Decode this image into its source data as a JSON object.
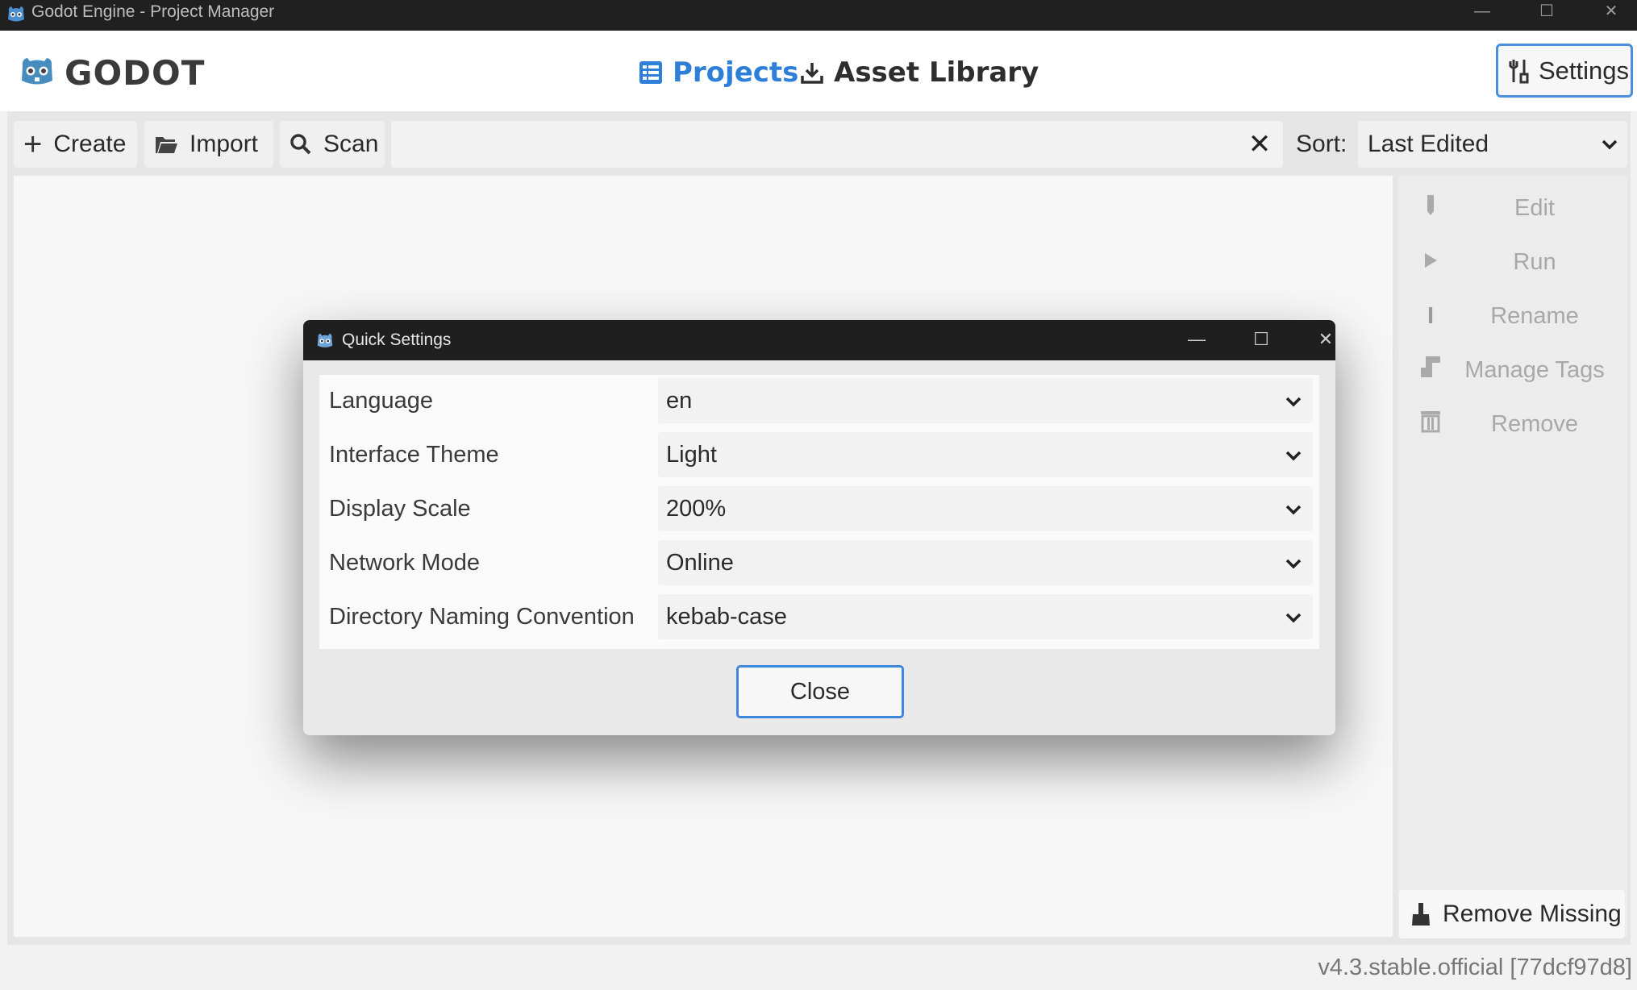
{
  "window": {
    "title": "Godot Engine - Project Manager",
    "controls": [
      "minimize-icon",
      "maximize-icon",
      "close-icon"
    ]
  },
  "header": {
    "logo_text": "GODOT",
    "tabs": [
      {
        "label": "Projects",
        "icon": "project-list-icon",
        "active": true
      },
      {
        "label": "Asset Library",
        "icon": "download-icon",
        "active": false
      }
    ],
    "settings_label": "Settings"
  },
  "toolbar": {
    "create_label": "Create",
    "import_label": "Import",
    "scan_label": "Scan",
    "search": {
      "value": "",
      "placeholder": ""
    },
    "sort_label": "Sort:",
    "sort_value": "Last Edited"
  },
  "side_panel": {
    "items": [
      {
        "label": "Edit",
        "icon": "pencil-icon",
        "enabled": false
      },
      {
        "label": "Run",
        "icon": "play-icon",
        "enabled": false
      },
      {
        "label": "Rename",
        "icon": "text-cursor-icon",
        "enabled": false
      },
      {
        "label": "Manage Tags",
        "icon": "tag-icon",
        "enabled": false
      },
      {
        "label": "Remove",
        "icon": "trash-icon",
        "enabled": false
      }
    ],
    "remove_missing_label": "Remove Missing"
  },
  "version": "v4.3.stable.official [77dcf97d8]",
  "dialog": {
    "title": "Quick Settings",
    "rows": [
      {
        "label": "Language",
        "value": "en"
      },
      {
        "label": "Interface Theme",
        "value": "Light"
      },
      {
        "label": "Display Scale",
        "value": "200%"
      },
      {
        "label": "Network Mode",
        "value": "Online"
      },
      {
        "label": "Directory Naming Convention",
        "value": "kebab-case"
      }
    ],
    "close_label": "Close"
  },
  "colors": {
    "accent": "#2e7fd8",
    "focus_border": "#4a8fe0",
    "titlebar": "#202020",
    "disabled_text": "#a8a8a8"
  }
}
